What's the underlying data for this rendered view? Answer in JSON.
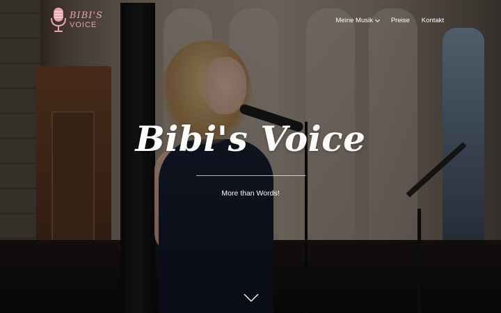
{
  "brand": {
    "logo_line1": "BIBI'S",
    "logo_line2": "VOICE",
    "logo_color": "#e8a3ae"
  },
  "nav": {
    "items": [
      {
        "label": "Meine Musik",
        "has_dropdown": true
      },
      {
        "label": "Preise",
        "has_dropdown": false
      },
      {
        "label": "Kontakt",
        "has_dropdown": false
      }
    ]
  },
  "hero": {
    "title": "Bibi's Voice",
    "subtitle": "More than Words!",
    "scroll_icon": "chevron-down-icon"
  }
}
